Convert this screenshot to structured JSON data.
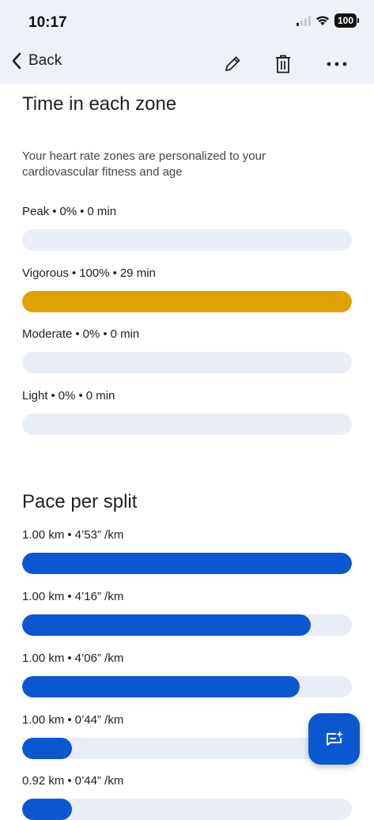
{
  "status_bar": {
    "time": "10:17",
    "battery": "100"
  },
  "nav": {
    "back_label": "Back",
    "icons": [
      "edit-icon",
      "delete-icon",
      "more-icon"
    ]
  },
  "zones": {
    "title": "Time in each zone",
    "subtitle": "Your heart rate zones are personalized to your cardiovascular fitness and age",
    "accent_color": "#e0a100",
    "track_color": "#e9eef6",
    "items": [
      {
        "name": "Peak",
        "percent": "0%",
        "duration": "0 min",
        "fraction": 0
      },
      {
        "name": "Vigorous",
        "percent": "100%",
        "duration": "29 min",
        "fraction": 1
      },
      {
        "name": "Moderate",
        "percent": "0%",
        "duration": "0 min",
        "fraction": 0
      },
      {
        "name": "Light",
        "percent": "0%",
        "duration": "0 min",
        "fraction": 0
      }
    ]
  },
  "pace": {
    "title": "Pace per split",
    "accent_color": "#0b57d0",
    "items": [
      {
        "distance": "1.00 km",
        "pace": "4’53” /km",
        "fraction": 1.0
      },
      {
        "distance": "1.00 km",
        "pace": "4’16” /km",
        "fraction": 0.876
      },
      {
        "distance": "1.00 km",
        "pace": "4’06” /km",
        "fraction": 0.842
      },
      {
        "distance": "1.00 km",
        "pace": "0’44” /km",
        "fraction": 0.15
      },
      {
        "distance": "0.92 km",
        "pace": "0’44” /km",
        "fraction": 0.15
      }
    ]
  },
  "fab": {
    "icon": "ai-chat-icon"
  }
}
